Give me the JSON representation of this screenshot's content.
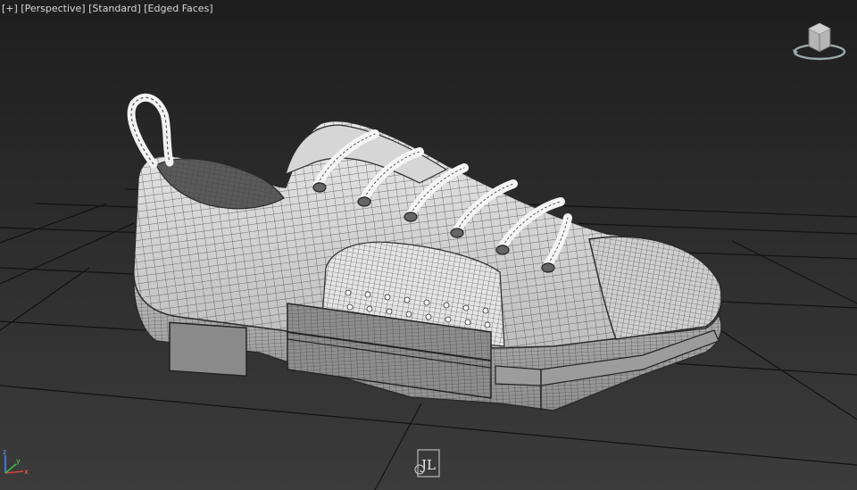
{
  "viewport": {
    "menu_label": "[+]",
    "view_label": "[Perspective]",
    "shading_label": "[Standard]",
    "display_label": "[Edged Faces]"
  },
  "viewcube": {
    "icon": "viewcube-icon"
  },
  "axis_gizmo": {
    "x_label": "x",
    "y_label": "y",
    "z_label": "z"
  },
  "watermark": {
    "text": "JL"
  },
  "colors": {
    "background_top": "#1f1f1f",
    "background_bottom": "#3a3a3a",
    "grid": "#0e0e0e",
    "mesh": "#dcdcdc",
    "wire": "#2a2a2a",
    "label": "#d8d8d8"
  }
}
